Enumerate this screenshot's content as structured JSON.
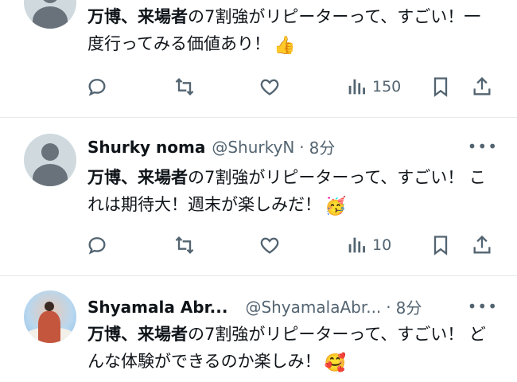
{
  "tweets": [
    {
      "name": "",
      "handle": "",
      "time": "",
      "text_bold": "万博、来場者",
      "text_rest": "の7割強がリピーターって、すごい！一度行ってみる価値あり！",
      "emoji": "👍",
      "views": "150"
    },
    {
      "name": "Shurky noma",
      "handle": "@ShurkyN",
      "time": "8分",
      "text_bold": "万博、来場者",
      "text_rest": "の7割強がリピーターって、すごい！ これは期待大！週末が楽しみだ！",
      "emoji": "🥳",
      "views": "10"
    },
    {
      "name": "Shyamala Abr...",
      "handle": "@ShyamalaAbr...",
      "time": "8分",
      "text_bold": "万博、来場者",
      "text_rest": "の7割強がリピーターって、すごい！ どんな体験ができるのか楽しみ！",
      "emoji": "🥰"
    }
  ],
  "icons": {
    "reply": "reply-icon",
    "retweet": "retweet-icon",
    "like": "like-icon",
    "views": "views-icon",
    "bookmark": "bookmark-icon",
    "share": "share-icon",
    "more": "more-icon"
  },
  "colors": {
    "text": "#0f1419",
    "secondary": "#536471",
    "avatar_bg": "#cfd9de",
    "divider": "#e6e9ec"
  },
  "more_glyph": "•••",
  "separator": "·"
}
